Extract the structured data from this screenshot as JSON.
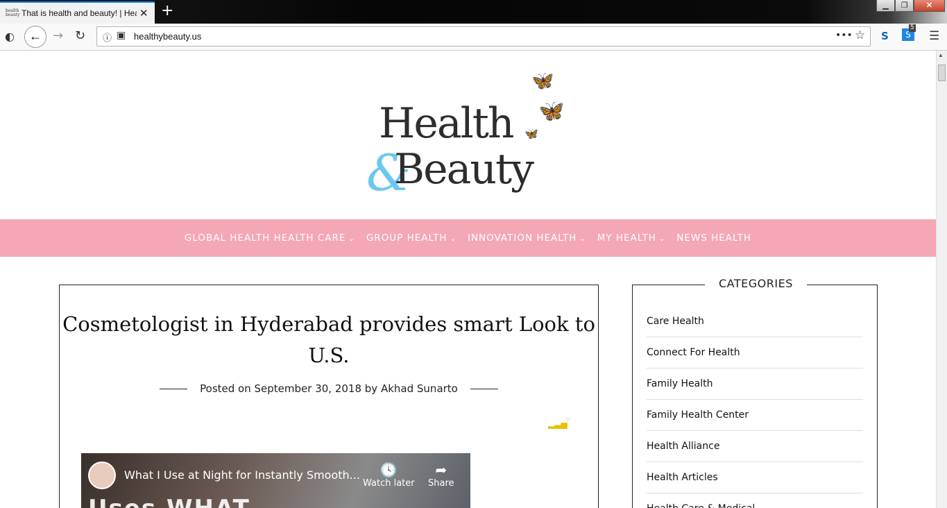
{
  "browser": {
    "tab_title": "That is health and beauty! | Hea",
    "tab_favicon_text": "health beauty",
    "url": "healthybeauty.us",
    "extension_badge": "5"
  },
  "logo": {
    "health": "Health",
    "amp": "&",
    "beauty": "Beauty"
  },
  "nav": {
    "items": [
      {
        "label": "GLOBAL HEALTH HEALTH CARE",
        "caret": "⌄"
      },
      {
        "label": "GROUP HEALTH",
        "caret": "⌄"
      },
      {
        "label": "INNOVATION HEALTH",
        "caret": "⌄"
      },
      {
        "label": "MY HEALTH",
        "caret": "⌄"
      },
      {
        "label": "NEWS HEALTH",
        "caret": ""
      }
    ]
  },
  "post": {
    "title": "Cosmetologist in Hyderabad provides smart Look to U.S.",
    "posted_on": "Posted on",
    "date": "September 30, 2018",
    "by": "by",
    "author": "Akhad Sunarto"
  },
  "video": {
    "title": "What I Use at Night for Instantly Smooth...",
    "watch_later": "Watch later",
    "share": "Share",
    "overlay": "Uses WHAT"
  },
  "sidebar": {
    "title": "CATEGORIES",
    "categories": [
      "Care Health",
      "Connect For Health",
      "Family Health",
      "Family Health Center",
      "Health Alliance",
      "Health Articles",
      "Health Care & Medical"
    ]
  }
}
